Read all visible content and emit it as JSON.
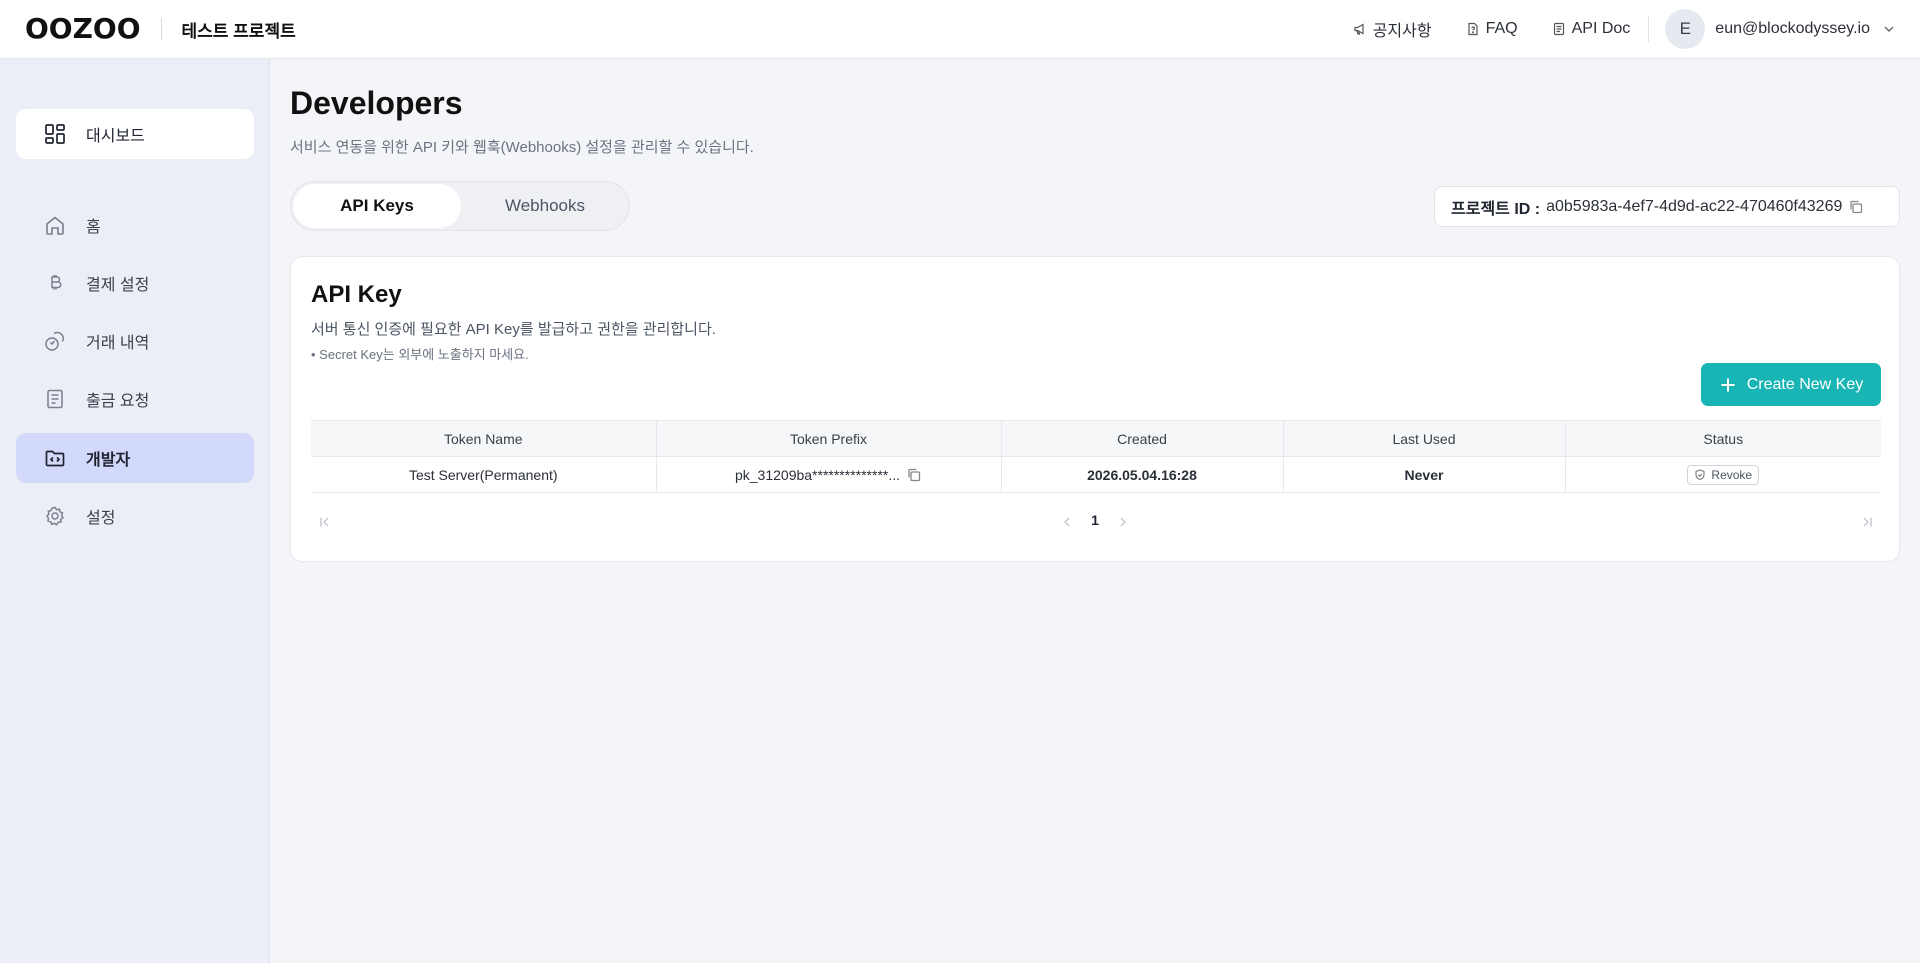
{
  "header": {
    "logo": "OOZOO",
    "project_name": "테스트 프로젝트",
    "links": {
      "notice": "공지사항",
      "faq": "FAQ",
      "api_doc": "API Doc"
    },
    "user": {
      "avatar_initial": "E",
      "email": "eun@blockodyssey.io"
    }
  },
  "sidebar": {
    "dashboard": "대시보드",
    "items": [
      {
        "label": "홈",
        "icon": "home-icon"
      },
      {
        "label": "결제 설정",
        "icon": "bitcoin-icon"
      },
      {
        "label": "거래 내역",
        "icon": "coins-icon"
      },
      {
        "label": "출금 요청",
        "icon": "document-icon"
      },
      {
        "label": "개발자",
        "icon": "code-folder-icon",
        "active": true
      },
      {
        "label": "설정",
        "icon": "gear-icon"
      }
    ]
  },
  "main": {
    "title": "Developers",
    "subtitle": "서비스 연동을 위한 API 키와 웹훅(Webhooks) 설정을 관리할 수 있습니다.",
    "tabs": [
      {
        "label": "API Keys",
        "active": true
      },
      {
        "label": "Webhooks",
        "active": false
      }
    ],
    "project_id": {
      "label": "프로젝트 ID :",
      "value": "a0b5983a-4ef7-4d9d-ac22-470460f43269"
    },
    "card": {
      "title": "API Key",
      "description": "서버 통신 인증에 필요한 API Key를 발급하고 권한을 관리합니다.",
      "note": "• Secret Key는 외부에 노출하지 마세요.",
      "create_button": "Create New Key",
      "table": {
        "columns": [
          "Token Name",
          "Token Prefix",
          "Created",
          "Last Used",
          "Status"
        ],
        "rows": [
          {
            "token_name": "Test Server(Permanent)",
            "token_prefix": "pk_31209ba**************...",
            "created": "2026.05.04.16:28",
            "last_used": "Never",
            "status_action": "Revoke"
          }
        ]
      },
      "pagination": {
        "current_page": "1"
      }
    }
  },
  "colors": {
    "accent": "#19b5b5",
    "sidebar_active": "#d3d9fa",
    "sidebar_bg": "#eceef7",
    "page_bg": "#f4f5f9"
  }
}
